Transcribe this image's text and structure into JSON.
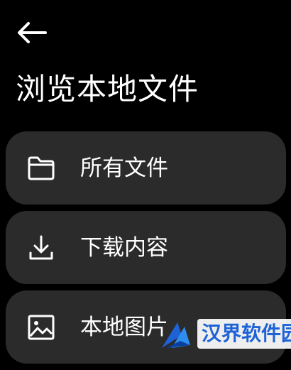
{
  "header": {
    "back_icon": "arrow-left-icon",
    "title": "浏览本地文件"
  },
  "list": {
    "items": [
      {
        "label": "所有文件",
        "icon": "folder-icon"
      },
      {
        "label": "下载内容",
        "icon": "download-icon"
      },
      {
        "label": "本地图片",
        "icon": "image-icon"
      }
    ]
  },
  "watermark": {
    "text": "汉界软件园",
    "color": "#1e63d6"
  },
  "colors": {
    "background": "#000000",
    "card": "#2b2b2b",
    "text": "#ffffff"
  }
}
